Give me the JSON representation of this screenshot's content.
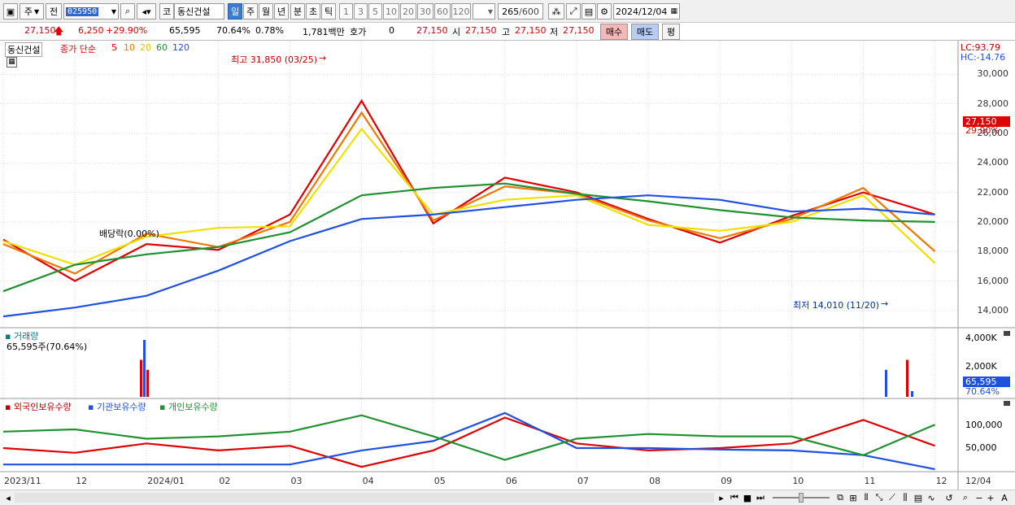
{
  "toolbar": {
    "market": "주",
    "prefix": "전",
    "code": "025950",
    "market2": "코",
    "stock_name": "동신건설",
    "periods": [
      "일",
      "주",
      "월",
      "년",
      "분",
      "초",
      "틱"
    ],
    "active_period": "일",
    "intervals": [
      "1",
      "3",
      "5",
      "10",
      "20",
      "30",
      "60",
      "120"
    ],
    "count": "265",
    "count_max": "/600",
    "date": "2024/12/04"
  },
  "info": {
    "price": "27,150",
    "change": "6,250",
    "change_pct": "+29.90%",
    "volume": "65,595",
    "vol_ratio": "70.64%",
    "turnover": "0.78%",
    "amount": "1,781백만",
    "quote_label": "호가",
    "quote_val": "0",
    "quote_price": "27,150",
    "open_label": "시",
    "open": "27,150",
    "high_label": "고",
    "high": "27,150",
    "low_label": "저",
    "low": "27,150",
    "buy": "매수",
    "sell": "매도",
    "eval": "평"
  },
  "chart": {
    "name_tag": "동신건설",
    "ma_title": "종가 단순",
    "ma_periods": [
      "5",
      "10",
      "20",
      "60",
      "120"
    ],
    "ma_colors": [
      "#e00000",
      "#f07800",
      "#f0e000",
      "#209030",
      "#2050e0"
    ],
    "lc": "LC:93.79",
    "hc": "HC:-14.76",
    "high_note": "최고 31,850 (03/25)",
    "low_note": "최저 14,010 (11/20)",
    "dividend_note": "배당락(0.00%)",
    "price_badge": "27,150",
    "pct_badge": "29.90%",
    "volume_title": "거래량",
    "volume_value": "65,595주(70.64%)",
    "vol_badge": "65,595",
    "vol_pct": "70.64%",
    "holdings_series": [
      "외국인보유수량",
      "기관보유수량",
      "개인보유수량"
    ],
    "holdings_colors": [
      "#e00000",
      "#2050e0",
      "#209030"
    ]
  },
  "chart_data": [
    {
      "type": "line",
      "title": "",
      "xlabel": "",
      "ylabel": "",
      "ylim": [
        13000,
        32000
      ],
      "x_ticks": [
        "2023/11",
        "12",
        "2024/01",
        "02",
        "03",
        "04",
        "05",
        "06",
        "07",
        "08",
        "09",
        "10",
        "11",
        "12",
        "12/04"
      ],
      "y_ticks": [
        "30,000",
        "28,000",
        "26,000",
        "24,000",
        "22,000",
        "20,000",
        "18,000",
        "16,000",
        "14,000"
      ],
      "annotations": [
        "최고 31,850 (03/25)",
        "최저 14,010 (11/20)",
        "배당락(0.00%)"
      ],
      "series": [
        {
          "name": "5",
          "x": [
            "2023/11",
            "12",
            "2024/01",
            "02",
            "03",
            "04",
            "05",
            "06",
            "07",
            "08",
            "09",
            "10",
            "11",
            "12"
          ],
          "values": [
            18800,
            16000,
            18500,
            18100,
            20500,
            28200,
            19900,
            23000,
            22000,
            20200,
            18600,
            20400,
            22000,
            20500
          ]
        },
        {
          "name": "10",
          "x": [
            "2023/11",
            "12",
            "2024/01",
            "02",
            "03",
            "04",
            "05",
            "06",
            "07",
            "08",
            "09",
            "10",
            "11",
            "12"
          ],
          "values": [
            18500,
            16500,
            19200,
            18300,
            20000,
            27400,
            20100,
            22400,
            21900,
            20100,
            18900,
            20200,
            22300,
            18000
          ]
        },
        {
          "name": "20",
          "x": [
            "2023/11",
            "12",
            "2024/01",
            "02",
            "03",
            "04",
            "05",
            "06",
            "07",
            "08",
            "09",
            "10",
            "11",
            "12"
          ],
          "values": [
            18700,
            17100,
            19000,
            19600,
            19700,
            26300,
            20500,
            21500,
            21800,
            19800,
            19400,
            20000,
            21800,
            17200
          ]
        },
        {
          "name": "60",
          "x": [
            "2023/11",
            "12",
            "2024/01",
            "02",
            "03",
            "04",
            "05",
            "06",
            "07",
            "08",
            "09",
            "10",
            "11",
            "12"
          ],
          "values": [
            15300,
            17100,
            17800,
            18300,
            19300,
            21800,
            22300,
            22600,
            21900,
            21400,
            20800,
            20300,
            20100,
            20000
          ]
        },
        {
          "name": "120",
          "x": [
            "2023/11",
            "12",
            "2024/01",
            "02",
            "03",
            "04",
            "05",
            "06",
            "07",
            "08",
            "09",
            "10",
            "11",
            "12"
          ],
          "values": [
            13600,
            14200,
            15000,
            16700,
            18700,
            20200,
            20500,
            21000,
            21500,
            21800,
            21500,
            20700,
            20900,
            20500
          ]
        }
      ]
    },
    {
      "type": "bar",
      "title": "거래량",
      "y_ticks": [
        "4,000K",
        "2,000K"
      ],
      "ylim": [
        0,
        4000
      ],
      "categories": [
        "2024/01 a",
        "2024/01 b",
        "2024/01 c",
        "11",
        "12 a",
        "12 b"
      ],
      "values": [
        2600,
        4000,
        1900,
        1900,
        2600,
        400
      ]
    },
    {
      "type": "line",
      "title": "",
      "y_ticks": [
        "100,000",
        "50,000"
      ],
      "ylim": [
        0,
        130000
      ],
      "series": [
        {
          "name": "외국인보유수량",
          "x": [
            "2023/11",
            "12",
            "2024/01",
            "02",
            "03",
            "04",
            "05",
            "06",
            "07",
            "08",
            "09",
            "10",
            "11",
            "12"
          ],
          "values": [
            45000,
            35000,
            55000,
            40000,
            50000,
            5000,
            40000,
            110000,
            55000,
            40000,
            45000,
            55000,
            105000,
            50000
          ]
        },
        {
          "name": "기관보유수량",
          "x": [
            "2023/11",
            "12",
            "2024/01",
            "02",
            "03",
            "04",
            "05",
            "06",
            "07",
            "08",
            "09",
            "10",
            "11",
            "12"
          ],
          "values": [
            10000,
            10000,
            10000,
            10000,
            10000,
            40000,
            60000,
            120000,
            45000,
            45000,
            42000,
            40000,
            30000,
            0
          ]
        },
        {
          "name": "개인보유수량",
          "x": [
            "2023/11",
            "12",
            "2024/01",
            "02",
            "03",
            "04",
            "05",
            "06",
            "07",
            "08",
            "09",
            "10",
            "11",
            "12"
          ],
          "values": [
            80000,
            85000,
            65000,
            70000,
            80000,
            115000,
            70000,
            20000,
            65000,
            75000,
            70000,
            70000,
            30000,
            95000
          ]
        }
      ]
    }
  ]
}
